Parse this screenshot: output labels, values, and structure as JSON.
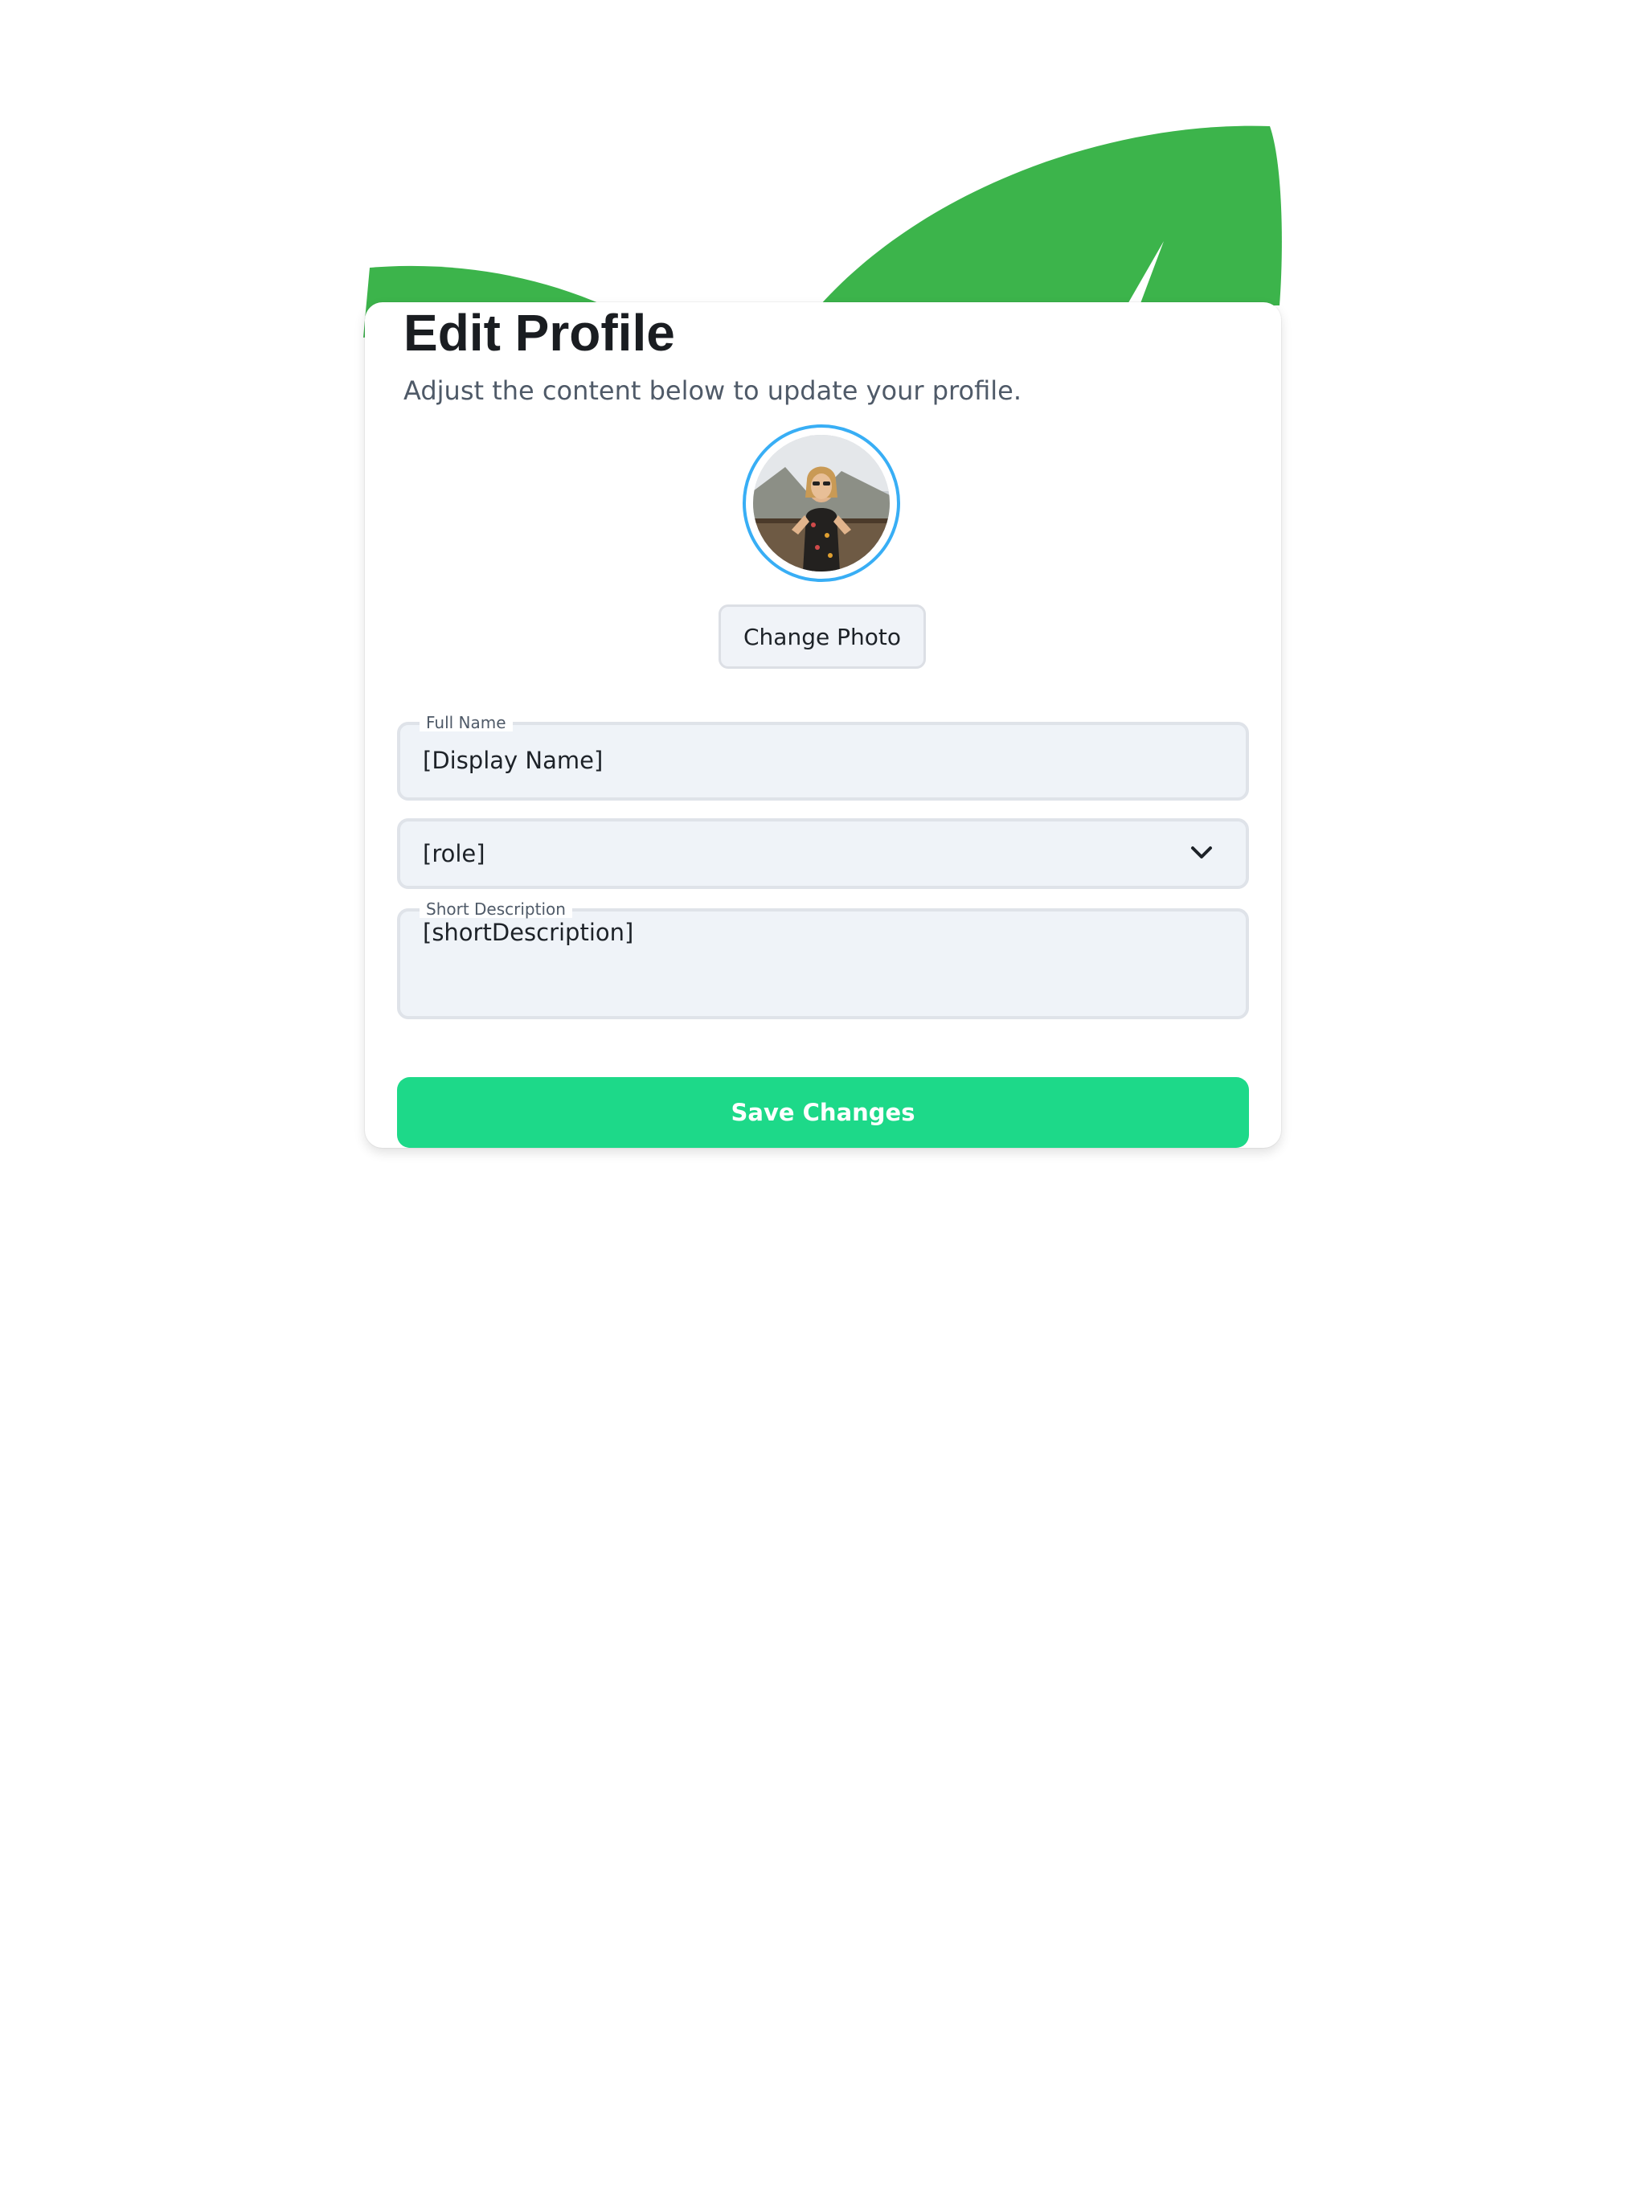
{
  "header": {
    "title": "Edit Profile",
    "subtitle": "Adjust the content below to update your profile."
  },
  "avatar": {
    "alt": "Profile photo"
  },
  "photo": {
    "change_label": "Change Photo"
  },
  "form": {
    "full_name": {
      "label": "Full Name",
      "value": "[Display Name]"
    },
    "role": {
      "value": "[role]"
    },
    "short_description": {
      "label": "Short Description",
      "value": "[shortDescription]"
    }
  },
  "actions": {
    "save_label": "Save Changes"
  },
  "colors": {
    "leaf": "#3cb44b",
    "accent": "#1dd989",
    "avatar_ring": "#38aef5"
  },
  "icons": {
    "select_caret": "chevron-down-icon"
  }
}
